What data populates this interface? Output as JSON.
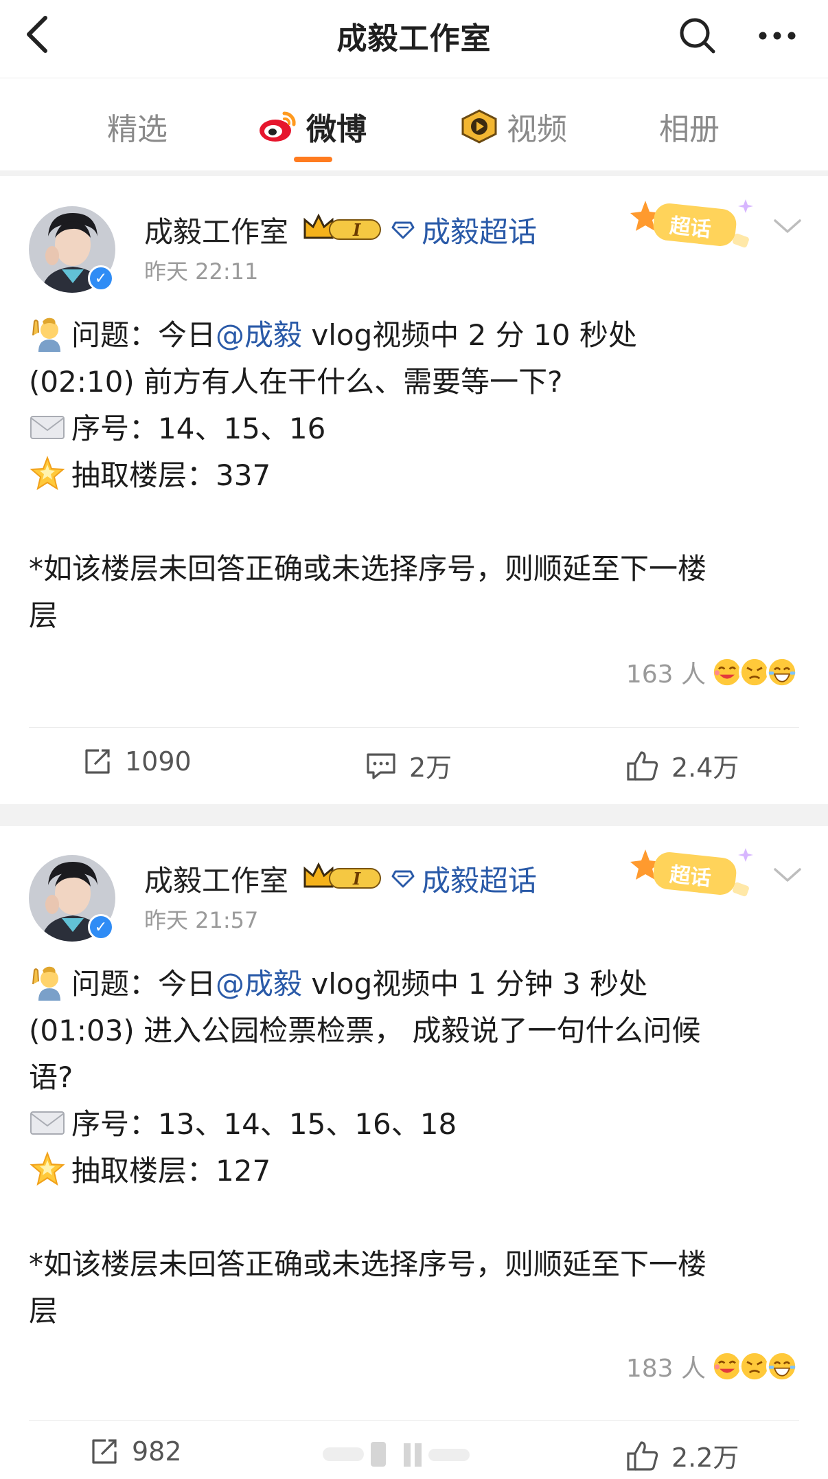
{
  "header": {
    "title": "成毅工作室"
  },
  "tabs": [
    {
      "label": "精选"
    },
    {
      "label": "微博"
    },
    {
      "label": "视频"
    },
    {
      "label": "相册"
    }
  ],
  "posts": [
    {
      "author": "成毅工作室",
      "level_badge": "I",
      "topic": "成毅超话",
      "time": "昨天 22:11",
      "chaohua_label": "超话",
      "lines": [
        {
          "pre": "问题：今日",
          "mention": "@成毅",
          "post": " vlog视频中 2 分 10 秒处"
        },
        {
          "text": "(02:10) 前方有人在干什么、需要等一下?"
        },
        {
          "text": "序号：14、15、16"
        },
        {
          "text": "抽取楼层：337"
        },
        {
          "text": "*如该楼层未回答正确或未选择序号，则顺延至下一楼"
        },
        {
          "text": "层"
        }
      ],
      "reaction_count": "163 人",
      "reposts": "1090",
      "comments": "2万",
      "likes": "2.4万"
    },
    {
      "author": "成毅工作室",
      "level_badge": "I",
      "topic": "成毅超话",
      "time": "昨天 21:57",
      "chaohua_label": "超话",
      "lines": [
        {
          "pre": "问题：今日",
          "mention": "@成毅",
          "post": " vlog视频中 1 分钟 3 秒处"
        },
        {
          "text": "(01:03) 进入公园检票检票， 成毅说了一句什么问候"
        },
        {
          "text": "语?"
        },
        {
          "text": "序号：13、14、15、16、18"
        },
        {
          "text": "抽取楼层：127"
        },
        {
          "text": "*如该楼层未回答正确或未选择序号，则顺延至下一楼"
        },
        {
          "text": "层"
        }
      ],
      "reaction_count": "183 人",
      "reposts": "982",
      "comments": "",
      "likes": "2.2万"
    }
  ],
  "colors": {
    "accent": "#ff7b1f",
    "link": "#2a5aa8",
    "verified": "#2f8cf5",
    "muted": "#9a9a9a"
  },
  "icons": [
    "back-icon",
    "search-icon",
    "more-icon",
    "weibo-logo-icon",
    "video-icon",
    "crown-icon",
    "diamond-icon",
    "chevron-down-icon",
    "repost-icon",
    "comment-icon",
    "like-icon",
    "raised-hand-emoji",
    "envelope-emoji",
    "glowing-star-emoji"
  ]
}
